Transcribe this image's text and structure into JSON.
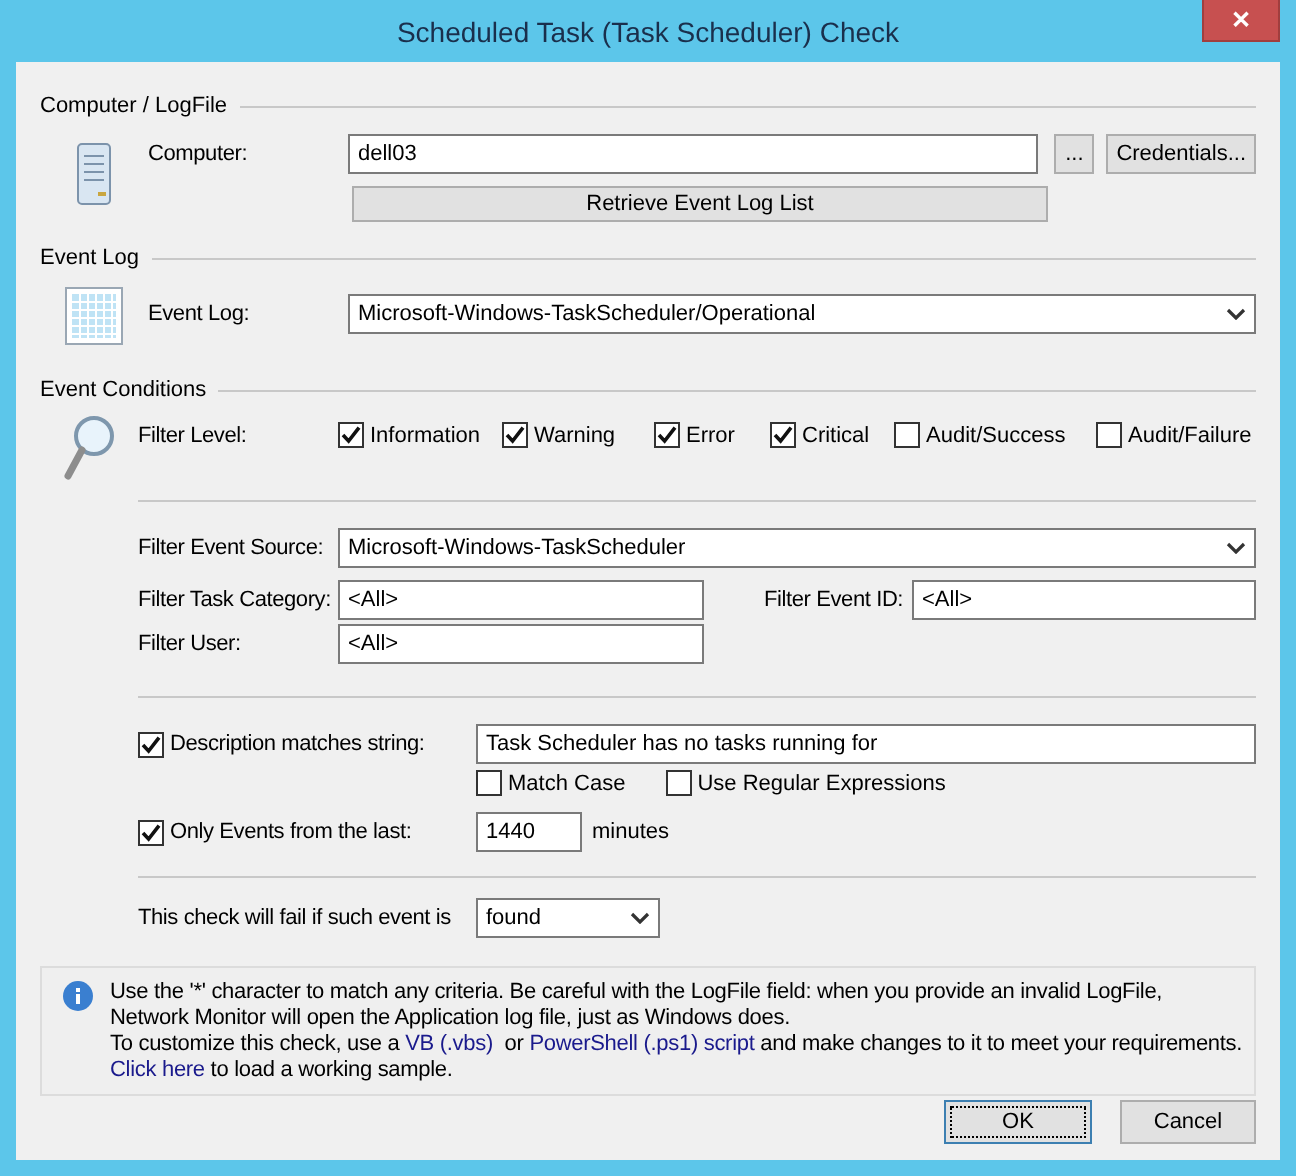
{
  "window": {
    "title": "Scheduled Task (Task Scheduler) Check",
    "close": "✕"
  },
  "computer_section": {
    "header": "Computer / LogFile",
    "label": "Computer:",
    "value": "dell03",
    "browse_button": "...",
    "credentials_button": "Credentials...",
    "retrieve_button": "Retrieve Event Log List"
  },
  "event_log_section": {
    "header": "Event Log",
    "label": "Event Log:",
    "value": "Microsoft-Windows-TaskScheduler/Operational"
  },
  "conditions": {
    "header": "Event Conditions",
    "filter_level_label": "Filter Level:",
    "levels": [
      {
        "label": "Information",
        "checked": true
      },
      {
        "label": "Warning",
        "checked": true
      },
      {
        "label": "Error",
        "checked": true
      },
      {
        "label": "Critical",
        "checked": true
      },
      {
        "label": "Audit/Success",
        "checked": false
      },
      {
        "label": "Audit/Failure",
        "checked": false
      }
    ],
    "source_label": "Filter Event Source:",
    "source_value": "Microsoft-Windows-TaskScheduler",
    "category_label": "Filter Task Category:",
    "category_value": "<All>",
    "event_id_label": "Filter Event ID:",
    "event_id_value": "<All>",
    "user_label": "Filter User:",
    "user_value": "<All>",
    "description": {
      "label": "Description matches string:",
      "checked": true,
      "value": "Task Scheduler has no tasks running for"
    },
    "match_case": {
      "label": "Match Case",
      "checked": false
    },
    "regex": {
      "label": "Use Regular Expressions",
      "checked": false
    },
    "only_events": {
      "label": "Only Events from the last:",
      "checked": true,
      "value": "1440",
      "unit": "minutes"
    },
    "fail_label": "This check will fail if such event is",
    "fail_value": "found"
  },
  "info": {
    "paragraph": "Use the '*' character to match any criteria. Be careful with the LogFile field: when you provide an invalid LogFile, Network Monitor will open the Application log file, just as Windows does.",
    "lines": [
      [
        {
          "kind": "text",
          "text": "To customize this check, use a "
        },
        {
          "kind": "link",
          "text": "VB (.vbs)"
        },
        {
          "kind": "text",
          "text": "  or "
        },
        {
          "kind": "link",
          "text": "PowerShell (.ps1) script"
        },
        {
          "kind": "text",
          "text": " and make changes to it to meet your requirements."
        }
      ],
      [
        {
          "kind": "link",
          "text": "Click here"
        },
        {
          "kind": "text",
          "text": " to load a working sample."
        }
      ]
    ]
  },
  "buttons": [
    {
      "label": "OK",
      "selected": true
    },
    {
      "label": "Cancel",
      "selected": false
    }
  ]
}
